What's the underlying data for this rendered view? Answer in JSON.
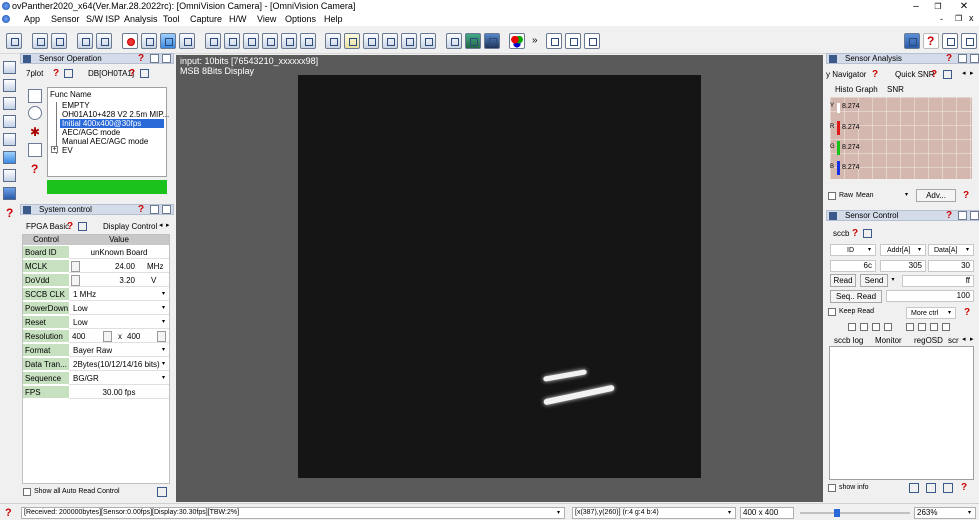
{
  "window": {
    "title": "ovPanther2020_x64(Ver.Mar.28.2022rc): [OmniVision Camera] - [OmniVision Camera]",
    "minimize": "–",
    "maximize": "❐",
    "close": "✕",
    "child_minimize": "-",
    "child_restore": "❐",
    "child_close": "x"
  },
  "menu": [
    "App",
    "Sensor",
    "S/W ISP",
    "Analysis",
    "Tool",
    "Capture",
    "H/W",
    "View",
    "Options",
    "Help"
  ],
  "toolbar_extra": "»",
  "sensor_operation": {
    "title": "Sensor Operation",
    "tabs": [
      "7plot",
      "DB[OH0TA1]"
    ],
    "func_header": "Func Name",
    "functions": [
      "EMPTY",
      "OH01A10+428 V2 2.5m MIP...",
      "Initial 400x400@30fps",
      "AEC/AGC mode",
      "Manual AEC/AGC mode",
      "EV"
    ],
    "selected_index": 2,
    "expand_symbol": "+",
    "status_color": "#1cc21c"
  },
  "system_control": {
    "title": "System control",
    "tabs": [
      "FPGA Basic",
      "Display Control"
    ],
    "col_control": "Control",
    "col_value": "Value",
    "rows": {
      "board_id": {
        "label": "Board ID",
        "value": "unKnown Board"
      },
      "mclk": {
        "label": "MCLK",
        "value": "24.00",
        "unit": "MHz"
      },
      "dovdd": {
        "label": "DoVdd",
        "value": "3.20",
        "unit": "V"
      },
      "sccb_clk": {
        "label": "SCCB CLK",
        "value": "1 MHz"
      },
      "powerdown": {
        "label": "PowerDown",
        "value": "Low"
      },
      "reset": {
        "label": "Reset",
        "value": "Low"
      },
      "resolution": {
        "label": "Resolution",
        "w": "400",
        "x": "x",
        "h": "400"
      },
      "format": {
        "label": "Format",
        "value": "Bayer Raw"
      },
      "data_trans": {
        "label": "Data Tran...",
        "value": "2Bytes(10/12/14/16 bits)"
      },
      "sequence": {
        "label": "Sequence",
        "value": "BG/GR"
      },
      "fps": {
        "label": "FPS",
        "value": "30.00 fps"
      }
    },
    "show_all_label": "Show all Auto Read Control"
  },
  "display": {
    "line1": "input: 10bits [76543210_xxxxxx98]",
    "line2": "MSB 8Bits Display"
  },
  "sensor_analysis": {
    "title": "Sensor Analysis",
    "tabs": [
      "y Navigator",
      "Quick SNR"
    ],
    "subtabs": [
      "Histo Graph",
      "SNR"
    ],
    "histo": [
      {
        "ch": "Y",
        "value": "8.274",
        "color": "#ffffff"
      },
      {
        "ch": "R",
        "value": "8.274",
        "color": "#e01818"
      },
      {
        "ch": "G",
        "value": "8.274",
        "color": "#18c018"
      },
      {
        "ch": "B",
        "value": "8.274",
        "color": "#1830e0"
      }
    ],
    "raw_label": "Raw",
    "mean_label": "Mean",
    "adv_label": "Adv..."
  },
  "sensor_control": {
    "title": "Sensor Control",
    "tab": "sccb",
    "col_id": "ID",
    "col_addr": "Addr[A]",
    "col_data": "Data[A]",
    "id_value": "6c",
    "addr_value": "305",
    "data_value": "30",
    "read_label": "Read",
    "send_label": "Send",
    "send_value": "ff",
    "seq_read_label": "Seq.. Read",
    "seq_value": "100",
    "keep_read_label": "Keep Read",
    "more_ctrl_label": "More ctrl",
    "log_tabs": [
      "sccb log",
      "Monitor",
      "regOSD",
      "scr"
    ],
    "show_info_label": "show info"
  },
  "status": {
    "received": "[Received: 200000bytes][Sensor:0.00fps][Display:30.30fps][TBW:2%]",
    "pixel": "[x(387),y(260)] (r:4 g:4 b:4)",
    "resolution": "400 x 400",
    "zoom": "263%",
    "zoom_fraction": 0.33
  }
}
